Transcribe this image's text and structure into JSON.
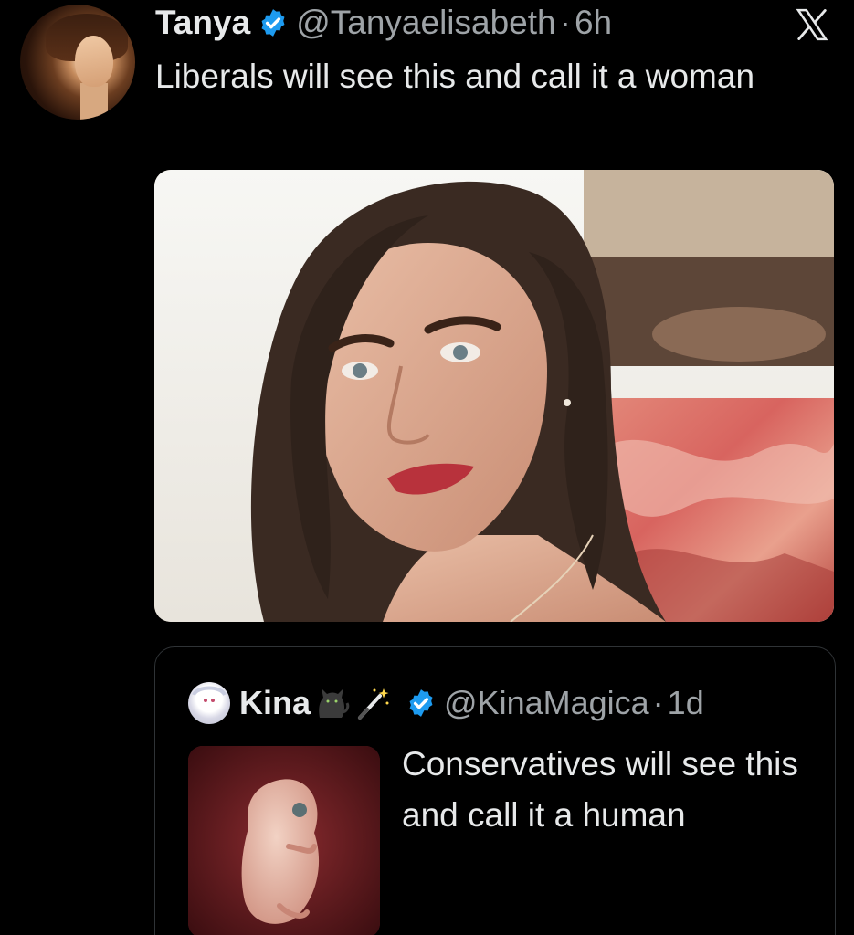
{
  "tweet": {
    "author_name": "Tanya",
    "handle": "@Tanyaelisabeth",
    "separator": "·",
    "time": "6h",
    "text": "Liberals will see this and call it a woman",
    "media_description": ""
  },
  "quoted_tweet": {
    "author_name": "Kina",
    "handle": "@KinaMagica",
    "separator": "·",
    "time": "1d",
    "text": "Conservatives will see this and call it a human"
  },
  "icons": {
    "platform": "x-logo-icon",
    "verified": "verified-badge-icon",
    "cat": "cat-emoji-icon",
    "wand": "magic-wand-emoji-icon"
  },
  "colors": {
    "background": "#000000",
    "text_primary": "#e7e9ea",
    "text_secondary": "#9ea3a7",
    "verified_blue": "#1d9bf0",
    "border": "#2f3336"
  }
}
